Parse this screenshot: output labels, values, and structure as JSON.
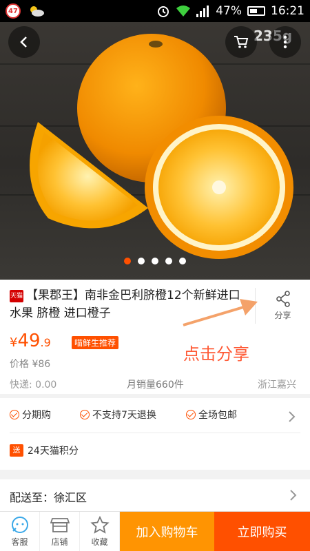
{
  "status_bar": {
    "notif_count": "47",
    "battery": "47%",
    "time": "16:21"
  },
  "hero": {
    "overlay_text": "235g",
    "slide_count": 5,
    "active_slide": 0
  },
  "product": {
    "store_tag": "天猫",
    "title": "【果郡王】南非金巴利脐橙12个新鲜进口水果 脐橙 进口橙子",
    "share_label": "分享",
    "currency": "¥",
    "price_int": "49",
    "price_dec": ".9",
    "promo_tag": "喵鲜生推荐",
    "original_price": "价格 ¥86",
    "shipping": "快递: 0.00",
    "monthly_sales": "月销量660件",
    "origin": "浙江嘉兴",
    "annotation": "点击分享"
  },
  "promo": {
    "guarantees": [
      "分期购",
      "不支持7天退换",
      "全场包邮"
    ],
    "points_tag": "送",
    "points_text": "24天猫积分"
  },
  "delivery": {
    "label": "配送至：徐汇区"
  },
  "bottom_bar": {
    "service_label": "客服",
    "store_label": "店铺",
    "favorite_label": "收藏",
    "add_to_cart": "加入购物车",
    "buy_now": "立即购买"
  },
  "colors": {
    "accent": "#ff5000",
    "cart": "#ff9402",
    "annotation": "#ff5a36"
  }
}
